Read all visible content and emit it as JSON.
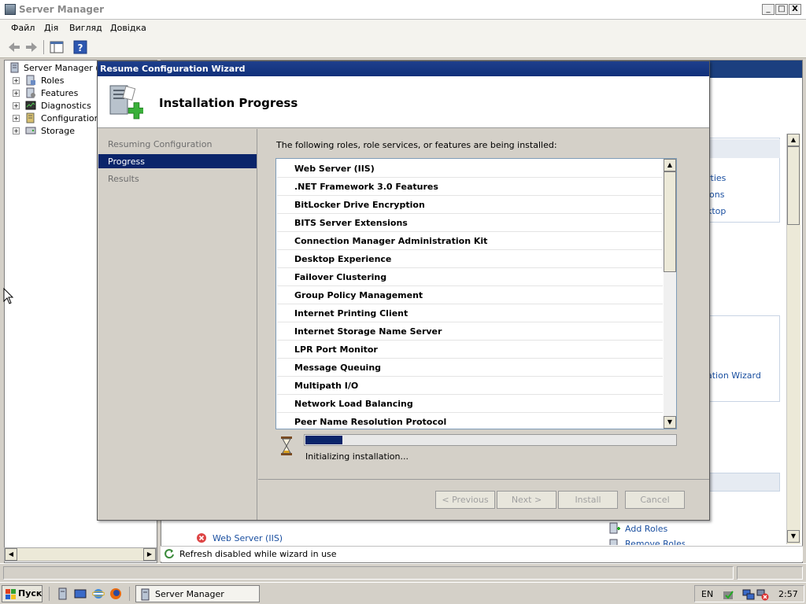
{
  "window": {
    "title": "Server Manager",
    "controls": {
      "minimize": "_",
      "maximize": "□",
      "close": "X"
    }
  },
  "menu": [
    "Файл",
    "Дія",
    "Вигляд",
    "Довідка"
  ],
  "tree": {
    "root": "Server Manager (W",
    "items": [
      "Roles",
      "Features",
      "Diagnostics",
      "Configuration",
      "Storage"
    ]
  },
  "right_pane": {
    "links": [
      "rties",
      "ions",
      "ktop",
      "l",
      "ation Wizard"
    ],
    "bottom_item": "Web Server (IIS)",
    "add_roles": "Add Roles",
    "remove_roles": "Remove Roles",
    "status": "Refresh disabled while wizard in use"
  },
  "wizard": {
    "title": "Resume Configuration Wizard",
    "heading": "Installation Progress",
    "steps": [
      {
        "label": "Resuming Configuration",
        "active": false
      },
      {
        "label": "Progress",
        "active": true
      },
      {
        "label": "Results",
        "active": false
      }
    ],
    "intro": "The following roles, role services, or features are being installed:",
    "items": [
      "Web Server (IIS)",
      ".NET Framework 3.0 Features",
      "BitLocker Drive Encryption",
      "BITS Server Extensions",
      "Connection Manager Administration Kit",
      "Desktop Experience",
      "Failover Clustering",
      "Group Policy Management",
      "Internet Printing Client",
      "Internet Storage Name Server",
      "LPR Port Monitor",
      "Message Queuing",
      "Multipath I/O",
      "Network Load Balancing",
      "Peer Name Resolution Protocol"
    ],
    "progress_fraction": 0.1,
    "progress_status": "Initializing installation...",
    "buttons": {
      "previous": "< Previous",
      "next": "Next >",
      "install": "Install",
      "cancel": "Cancel"
    }
  },
  "taskbar": {
    "start": "Пуск",
    "task": "Server Manager",
    "lang": "EN",
    "clock": "2:57"
  },
  "colors": {
    "wizard_title": "#10307a",
    "nav_active": "#0a246a",
    "progress": "#0a246a",
    "link": "#1a4fa0"
  }
}
